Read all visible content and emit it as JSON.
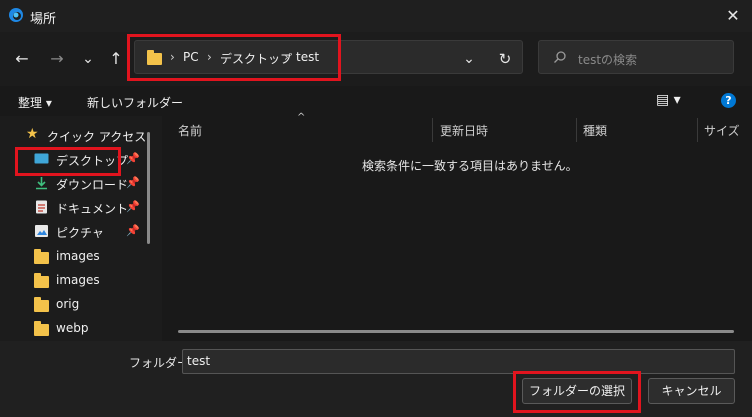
{
  "window": {
    "title": "場所",
    "close_glyph": "✕"
  },
  "nav": {
    "back": "←",
    "forward": "→",
    "recent": "⌄",
    "up": "↑",
    "dropdown": "⌄",
    "refresh": "↻"
  },
  "breadcrumb": {
    "items": [
      "PC",
      "デスクトップ",
      "test"
    ],
    "sep": "›"
  },
  "search": {
    "placeholder": "testの検索"
  },
  "toolbar": {
    "organize": "整理 ▾",
    "new_folder": "新しいフォルダー",
    "view": "▤ ▾",
    "help": "?"
  },
  "sidebar": {
    "items": [
      {
        "label": "クイック アクセス"
      },
      {
        "label": "デスクトップ",
        "pinned": true
      },
      {
        "label": "ダウンロード",
        "pinned": true
      },
      {
        "label": "ドキュメント",
        "pinned": true
      },
      {
        "label": "ピクチャ",
        "pinned": true
      },
      {
        "label": "images"
      },
      {
        "label": "images"
      },
      {
        "label": "orig"
      },
      {
        "label": "webp"
      }
    ],
    "pin_glyph": "📌"
  },
  "columns": [
    "名前",
    "更新日時",
    "種類",
    "サイズ"
  ],
  "sort_glyph": "^",
  "empty_message": "検索条件に一致する項目はありません。",
  "folder_field": {
    "label": "フォルダー:",
    "value": "test"
  },
  "buttons": {
    "select": "フォルダーの選択",
    "cancel": "キャンセル"
  },
  "colors": {
    "highlight": "#e1141e",
    "accent": "#0078d4",
    "folder": "#f3c24a"
  }
}
